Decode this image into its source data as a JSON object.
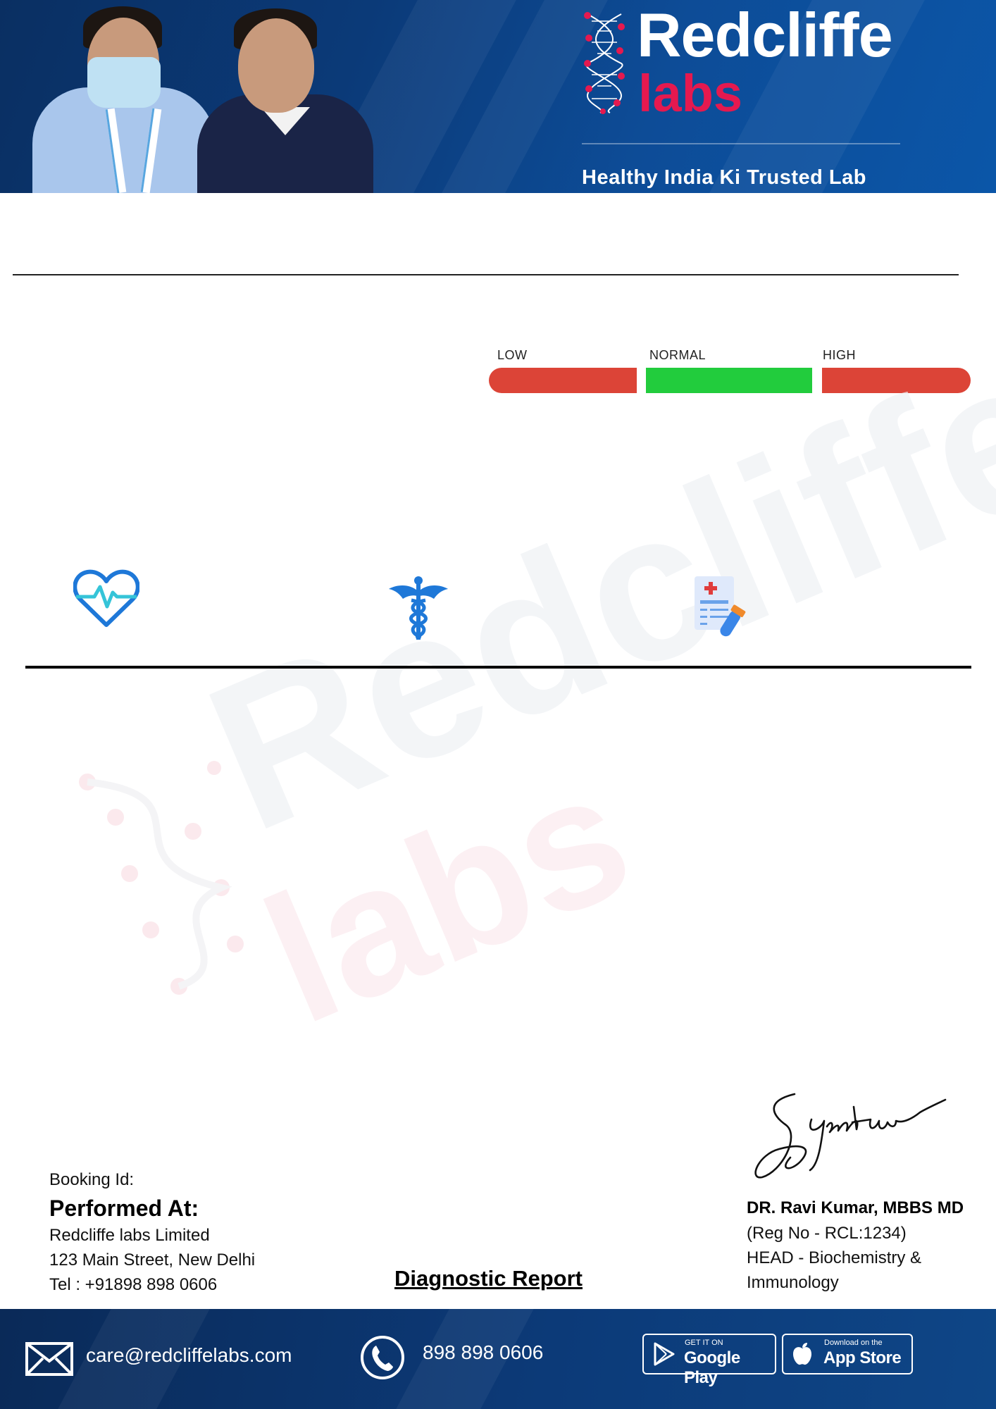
{
  "header": {
    "logo_line1": "Redcliffe",
    "logo_line2": "labs",
    "tagline": "Healthy India Ki Trusted Lab",
    "colors": {
      "banner": "#0b3a78",
      "brand_red": "#e5194f"
    }
  },
  "scale": {
    "low_label": "LOW",
    "normal_label": "NORMAL",
    "high_label": "HIGH",
    "colors": {
      "low": "#dc4437",
      "normal": "#22cc3d",
      "high": "#dc4437"
    }
  },
  "icons": [
    "heart-pulse-icon",
    "caduceus-icon",
    "medical-report-icon"
  ],
  "watermark": {
    "line1": "Redcliffe",
    "line2": "labs"
  },
  "booking": {
    "label": "Booking Id:"
  },
  "performed_at": {
    "title": "Performed At:",
    "lines": [
      "Redcliffe labs Limited",
      "123 Main Street, New Delhi",
      "Tel : +91898 898 0606"
    ]
  },
  "report_title": "Diagnostic Report",
  "doctor": {
    "name": "DR. Ravi Kumar, MBBS MD",
    "lines": [
      "(Reg No - RCL:1234)",
      "HEAD - Biochemistry &",
      "Immunology"
    ]
  },
  "footer": {
    "email": "care@redcliffelabs.com",
    "phone": "898 898 0606",
    "google_small": "GET IT ON",
    "google_big": "Google Play",
    "apple_small": "Download on the",
    "apple_big": "App Store"
  }
}
